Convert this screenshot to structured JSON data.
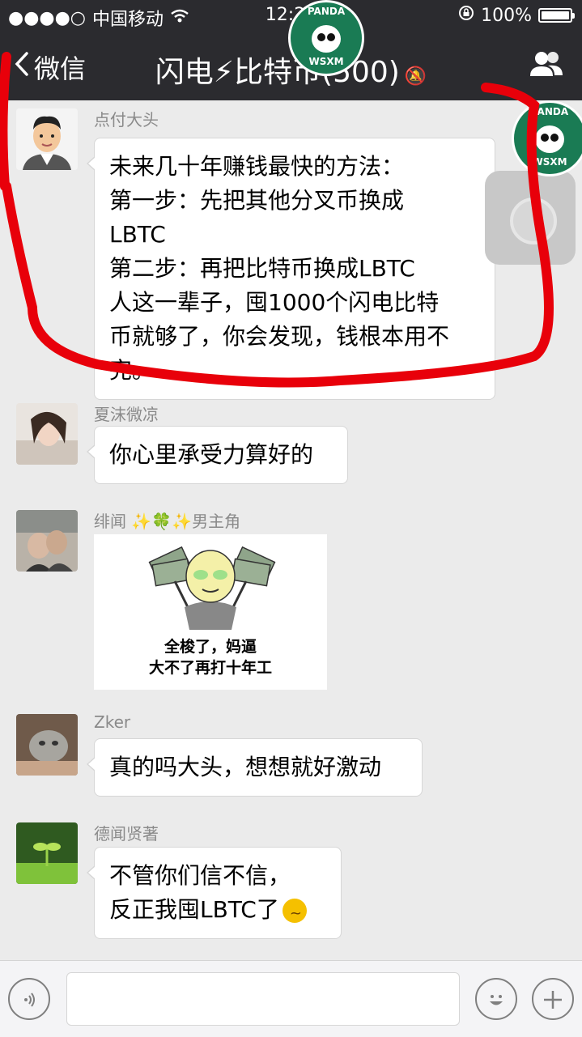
{
  "status": {
    "carrier": "中国移动",
    "time": "12:25",
    "battery": "100%",
    "battery_level": 1.0
  },
  "nav": {
    "back_label": "微信",
    "title": "闪电⚡比特币(500)",
    "users_icon": "group-icon",
    "mute_icon": "mute-bell-icon"
  },
  "watermark": {
    "top": "PANDA",
    "bottom": "WSXM"
  },
  "messages": [
    {
      "sender": "点付大头",
      "lines": [
        "未来几十年赚钱最快的方法：",
        "第一步：先把其他分叉币换成",
        "LBTC",
        "第二步：再把比特币换成LBTC",
        "人这一辈子，囤1000个闪电比特",
        "币就够了，你会发现，钱根本用不",
        "完。"
      ]
    },
    {
      "sender": "夏沫微凉",
      "lines": [
        "你心里承受力算好的"
      ]
    },
    {
      "sender": "绯闻 ✨🍀✨男主角",
      "sticker_lines": [
        "全梭了，妈逼",
        "大不了再打十年工"
      ]
    },
    {
      "sender": "Zker",
      "lines": [
        "真的吗大头，想想就好激动"
      ]
    },
    {
      "sender": "德闻贤著",
      "lines": [
        "不管你们信不信，",
        "反正我囤LBTC了"
      ]
    }
  ],
  "input": {
    "voice_icon": "voice-icon",
    "emoji_icon": "emoji-icon",
    "plus_icon": "plus-icon"
  },
  "colors": {
    "header_bg": "#2b2b2f",
    "chat_bg": "#ebebeb",
    "annotation_red": "#e8000a",
    "watermark_green": "#1a7b54"
  }
}
